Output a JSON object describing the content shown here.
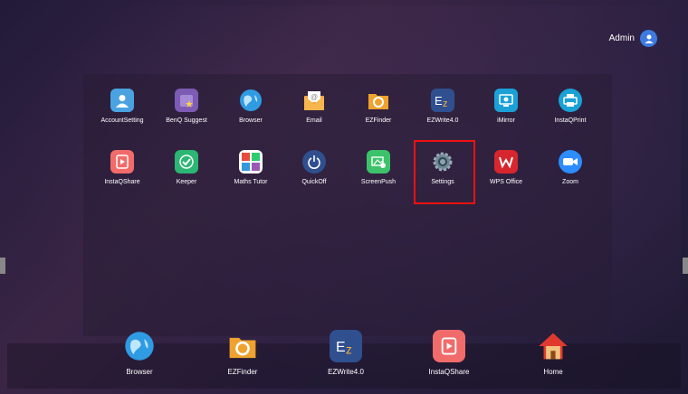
{
  "user": {
    "name": "Admin"
  },
  "apps_row1": [
    {
      "label": "AccountSetting",
      "icon": "account-icon"
    },
    {
      "label": "BenQ Suggest",
      "icon": "benq-suggest-icon"
    },
    {
      "label": "Browser",
      "icon": "browser-icon"
    },
    {
      "label": "Email",
      "icon": "email-icon"
    },
    {
      "label": "EZFinder",
      "icon": "ezfinder-icon"
    },
    {
      "label": "EZWrite4.0",
      "icon": "ezwrite-icon"
    },
    {
      "label": "iMirror",
      "icon": "imirror-icon"
    },
    {
      "label": "InstaQPrint",
      "icon": "instaqprint-icon"
    }
  ],
  "apps_row2": [
    {
      "label": "InstaQShare",
      "icon": "instaqshare-icon"
    },
    {
      "label": "Keeper",
      "icon": "keeper-icon"
    },
    {
      "label": "Maths Tutor",
      "icon": "maths-tutor-icon"
    },
    {
      "label": "QuickOff",
      "icon": "power-icon"
    },
    {
      "label": "ScreenPush",
      "icon": "screenpush-icon"
    },
    {
      "label": "Settings",
      "icon": "gear-icon"
    },
    {
      "label": "WPS Office",
      "icon": "wps-icon"
    },
    {
      "label": "Zoom",
      "icon": "zoom-icon"
    }
  ],
  "dock": [
    {
      "label": "Browser"
    },
    {
      "label": "EZFinder"
    },
    {
      "label": "EZWrite4.0"
    },
    {
      "label": "InstaQShare"
    },
    {
      "label": "Home"
    }
  ]
}
